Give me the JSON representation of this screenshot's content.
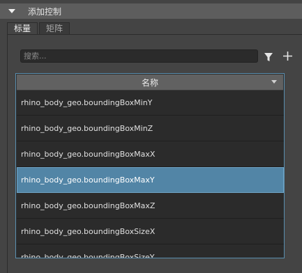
{
  "panel": {
    "title": "添加控制",
    "icon": "chevron-down-icon"
  },
  "tabs": [
    {
      "label": "标量",
      "active": true
    },
    {
      "label": "矩阵",
      "active": false
    }
  ],
  "search": {
    "placeholder": "搜索...",
    "value": ""
  },
  "toolbar": {
    "filter_icon": "filter-icon",
    "add_icon": "plus-icon"
  },
  "table": {
    "column_header": "名称",
    "rows": [
      {
        "label": "rhino_body_geo.boundingBoxMinY",
        "selected": false
      },
      {
        "label": "rhino_body_geo.boundingBoxMinZ",
        "selected": false
      },
      {
        "label": "rhino_body_geo.boundingBoxMaxX",
        "selected": false
      },
      {
        "label": "rhino_body_geo.boundingBoxMaxY",
        "selected": true
      },
      {
        "label": "rhino_body_geo.boundingBoxMaxZ",
        "selected": false
      },
      {
        "label": "rhino_body_geo.boundingBoxSizeX",
        "selected": false
      },
      {
        "label": "rhino_body_geo.boundingBoxSizeY",
        "selected": false
      }
    ]
  },
  "colors": {
    "selection": "#5285a6",
    "focus_border": "#5a8fb0"
  }
}
